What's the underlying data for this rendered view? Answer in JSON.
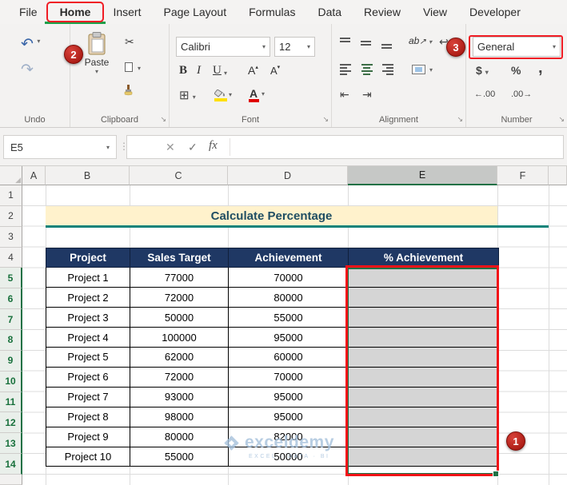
{
  "tabs": {
    "items": [
      "File",
      "Home",
      "Insert",
      "Page Layout",
      "Formulas",
      "Data",
      "Review",
      "View",
      "Developer"
    ]
  },
  "ribbon": {
    "undo_group": {
      "label": "Undo"
    },
    "clipboard_group": {
      "label": "Clipboard",
      "paste": "Paste"
    },
    "font_group": {
      "label": "Font",
      "font_name": "Calibri",
      "font_size": "12"
    },
    "alignment_group": {
      "label": "Alignment"
    },
    "number_group": {
      "label": "Number",
      "format": "General",
      "increase_decimal": "←.00",
      "decrease_decimal": ".00→"
    }
  },
  "formula_bar": {
    "name_box": "E5",
    "cancel": "✕",
    "enter": "✓",
    "fx": "fx"
  },
  "icons": {
    "undo": "↶",
    "redo": "↷",
    "dropdown": "▾",
    "launcher": "↘",
    "cut": "✂",
    "bold": "B",
    "italic": "I",
    "underline": "U",
    "size_up": "A",
    "size_up_mark": "▴",
    "size_down": "A",
    "size_down_mark": "▾",
    "borders": "⊞",
    "font_color": "A",
    "orientation": "ab",
    "orientation_mark": "↗",
    "wrap": "↩",
    "indent_decrease": "⇤",
    "indent_increase": "⇥",
    "currency": "$",
    "percent": "%",
    "comma": ",",
    "handle_dots": "⋮",
    "select_all_corner": "◢"
  },
  "grid": {
    "columns": [
      "A",
      "B",
      "C",
      "D",
      "E",
      "F"
    ],
    "rows": [
      "1",
      "2",
      "3",
      "4",
      "5",
      "6",
      "7",
      "8",
      "9",
      "10",
      "11",
      "12",
      "13",
      "14"
    ]
  },
  "sheet": {
    "title": "Calculate Percentage",
    "table": {
      "headers": [
        "Project",
        "Sales Target",
        "Achievement",
        "% Achievement"
      ],
      "rows": [
        [
          "Project 1",
          "77000",
          "70000",
          ""
        ],
        [
          "Project 2",
          "72000",
          "80000",
          ""
        ],
        [
          "Project 3",
          "50000",
          "55000",
          ""
        ],
        [
          "Project 4",
          "100000",
          "95000",
          ""
        ],
        [
          "Project 5",
          "62000",
          "60000",
          ""
        ],
        [
          "Project 6",
          "72000",
          "70000",
          ""
        ],
        [
          "Project 7",
          "93000",
          "95000",
          ""
        ],
        [
          "Project 8",
          "98000",
          "95000",
          ""
        ],
        [
          "Project 9",
          "80000",
          "82000",
          ""
        ],
        [
          "Project 10",
          "55000",
          "50000",
          ""
        ]
      ]
    }
  },
  "annotations": {
    "badge_1": "1",
    "badge_2": "2",
    "badge_3": "3"
  },
  "watermark": {
    "text": "exceldemy",
    "tagline": "EXCEL · DATA · BI"
  },
  "colors": {
    "accent_green": "#1E7145",
    "table_header_navy": "#1F3864",
    "title_fill": "#FFF2CC",
    "selection_gray": "#D5D5D5",
    "annotation_red": "#F01D25"
  }
}
